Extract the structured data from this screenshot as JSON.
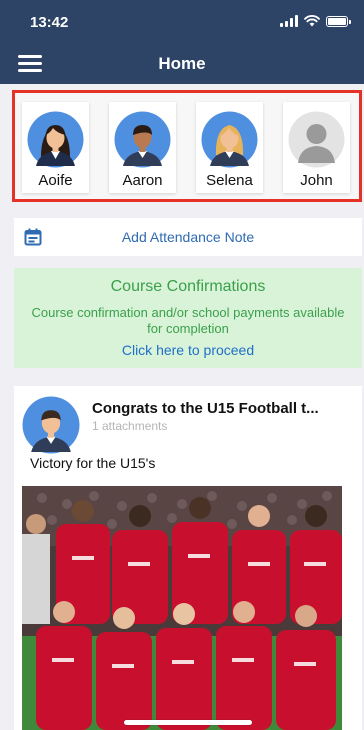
{
  "status_bar": {
    "time": "13:42"
  },
  "nav": {
    "title": "Home"
  },
  "children": [
    {
      "name": "Aoife",
      "avatar": "female-avatar-dark-hair"
    },
    {
      "name": "Aaron",
      "avatar": "male-avatar"
    },
    {
      "name": "Selena",
      "avatar": "female-avatar-blonde"
    },
    {
      "name": "John",
      "avatar": "placeholder-avatar"
    }
  ],
  "attendance": {
    "label": "Add Attendance Note",
    "icon": "calendar-icon"
  },
  "course": {
    "title": "Course Confirmations",
    "description": "Course confirmation and/or school payments available for completion",
    "link": "Click here to proceed"
  },
  "post": {
    "title": "Congrats to the U15 Football t...",
    "meta": "1 attachments",
    "text": "Victory for the U15's",
    "author_avatar": "male-avatar",
    "photo": "team-photo"
  },
  "colors": {
    "header": "#2d4466",
    "highlight_border": "#e53226",
    "link_blue": "#2f6bb3",
    "course_bg": "#d9f3d9",
    "course_text": "#3aa04a",
    "team_kit": "#c8102e"
  }
}
